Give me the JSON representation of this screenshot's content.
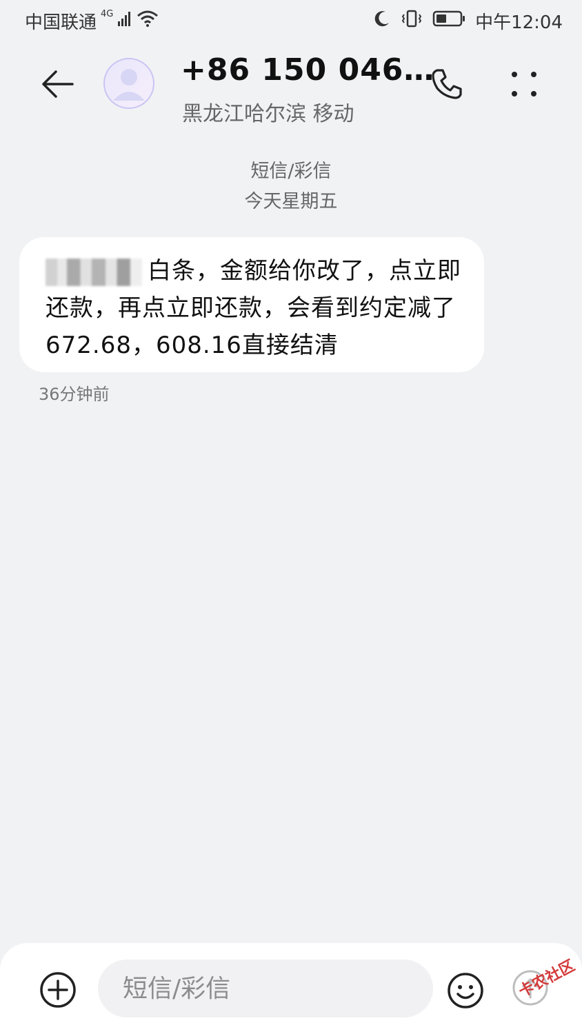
{
  "status_bar": {
    "carrier": "中国联通",
    "network_type": "4G",
    "time": "中午12:04",
    "icons": [
      "signal-icon",
      "wifi-icon",
      "moon-icon",
      "vibrate-icon",
      "battery-icon"
    ]
  },
  "header": {
    "contact_name": "+86 150 046…",
    "contact_location": "黑龙江哈尔滨 移动",
    "icons": [
      "back-arrow-icon",
      "avatar-icon",
      "phone-icon",
      "more-icon"
    ]
  },
  "conversation": {
    "channel": "短信/彩信",
    "date": "今天星期五",
    "messages": [
      {
        "text": "白条，金额给你改了，点立即还款，再点立即还款，会看到约定减了672.68，608.16直接结清",
        "time": "36分钟前"
      }
    ]
  },
  "composer": {
    "placeholder": "短信/彩信",
    "icons": [
      "add-icon",
      "emoji-icon",
      "send-icon"
    ]
  },
  "watermark": "卡农社区"
}
